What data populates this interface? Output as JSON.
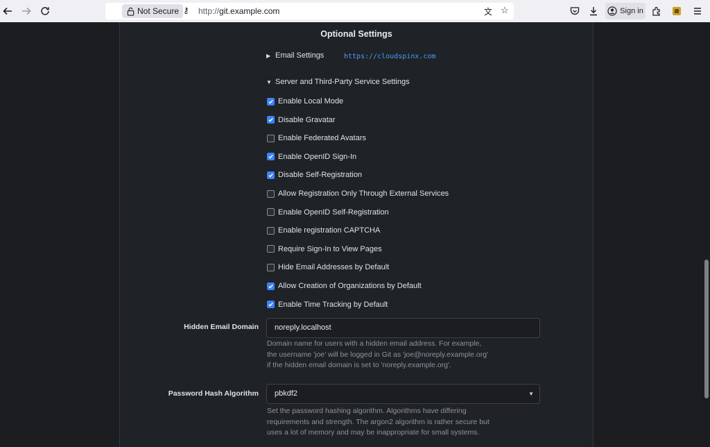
{
  "browser": {
    "security_label": "Not Secure",
    "url_scheme": "http://",
    "url_host": "git.example.com",
    "sign_in_label": "Sign in"
  },
  "page": {
    "section_title": "Optional Settings",
    "email_settings_label": "Email Settings",
    "server_settings_label": "Server and Third-Party Service Settings",
    "url_note": "https://cloudspinx.com",
    "checkboxes": [
      {
        "label": "Enable Local Mode",
        "checked": true
      },
      {
        "label": "Disable Gravatar",
        "checked": true
      },
      {
        "label": "Enable Federated Avatars",
        "checked": false
      },
      {
        "label": "Enable OpenID Sign-In",
        "checked": true
      },
      {
        "label": "Disable Self-Registration",
        "checked": true
      },
      {
        "label": "Allow Registration Only Through External Services",
        "checked": false
      },
      {
        "label": "Enable OpenID Self-Registration",
        "checked": false
      },
      {
        "label": "Enable registration CAPTCHA",
        "checked": false
      },
      {
        "label": "Require Sign-In to View Pages",
        "checked": false
      },
      {
        "label": "Hide Email Addresses by Default",
        "checked": false
      },
      {
        "label": "Allow Creation of Organizations by Default",
        "checked": true
      },
      {
        "label": "Enable Time Tracking by Default",
        "checked": true
      }
    ],
    "hidden_email": {
      "label": "Hidden Email Domain",
      "value": "noreply.localhost",
      "help": [
        "Domain name for users with a hidden email address. For example,",
        "the username 'joe' will be logged in Git as 'joe@noreply.example.org'",
        "if the hidden email domain is set to 'noreply.example.org'."
      ]
    },
    "password_hash": {
      "label": "Password Hash Algorithm",
      "value": "pbkdf2",
      "help": [
        "Set the password hashing algorithm. Algorithms have differing",
        "requirements and strength. The argon2 algorithm is rather secure but",
        "uses a lot of memory and may be inappropriate for small systems."
      ]
    }
  }
}
